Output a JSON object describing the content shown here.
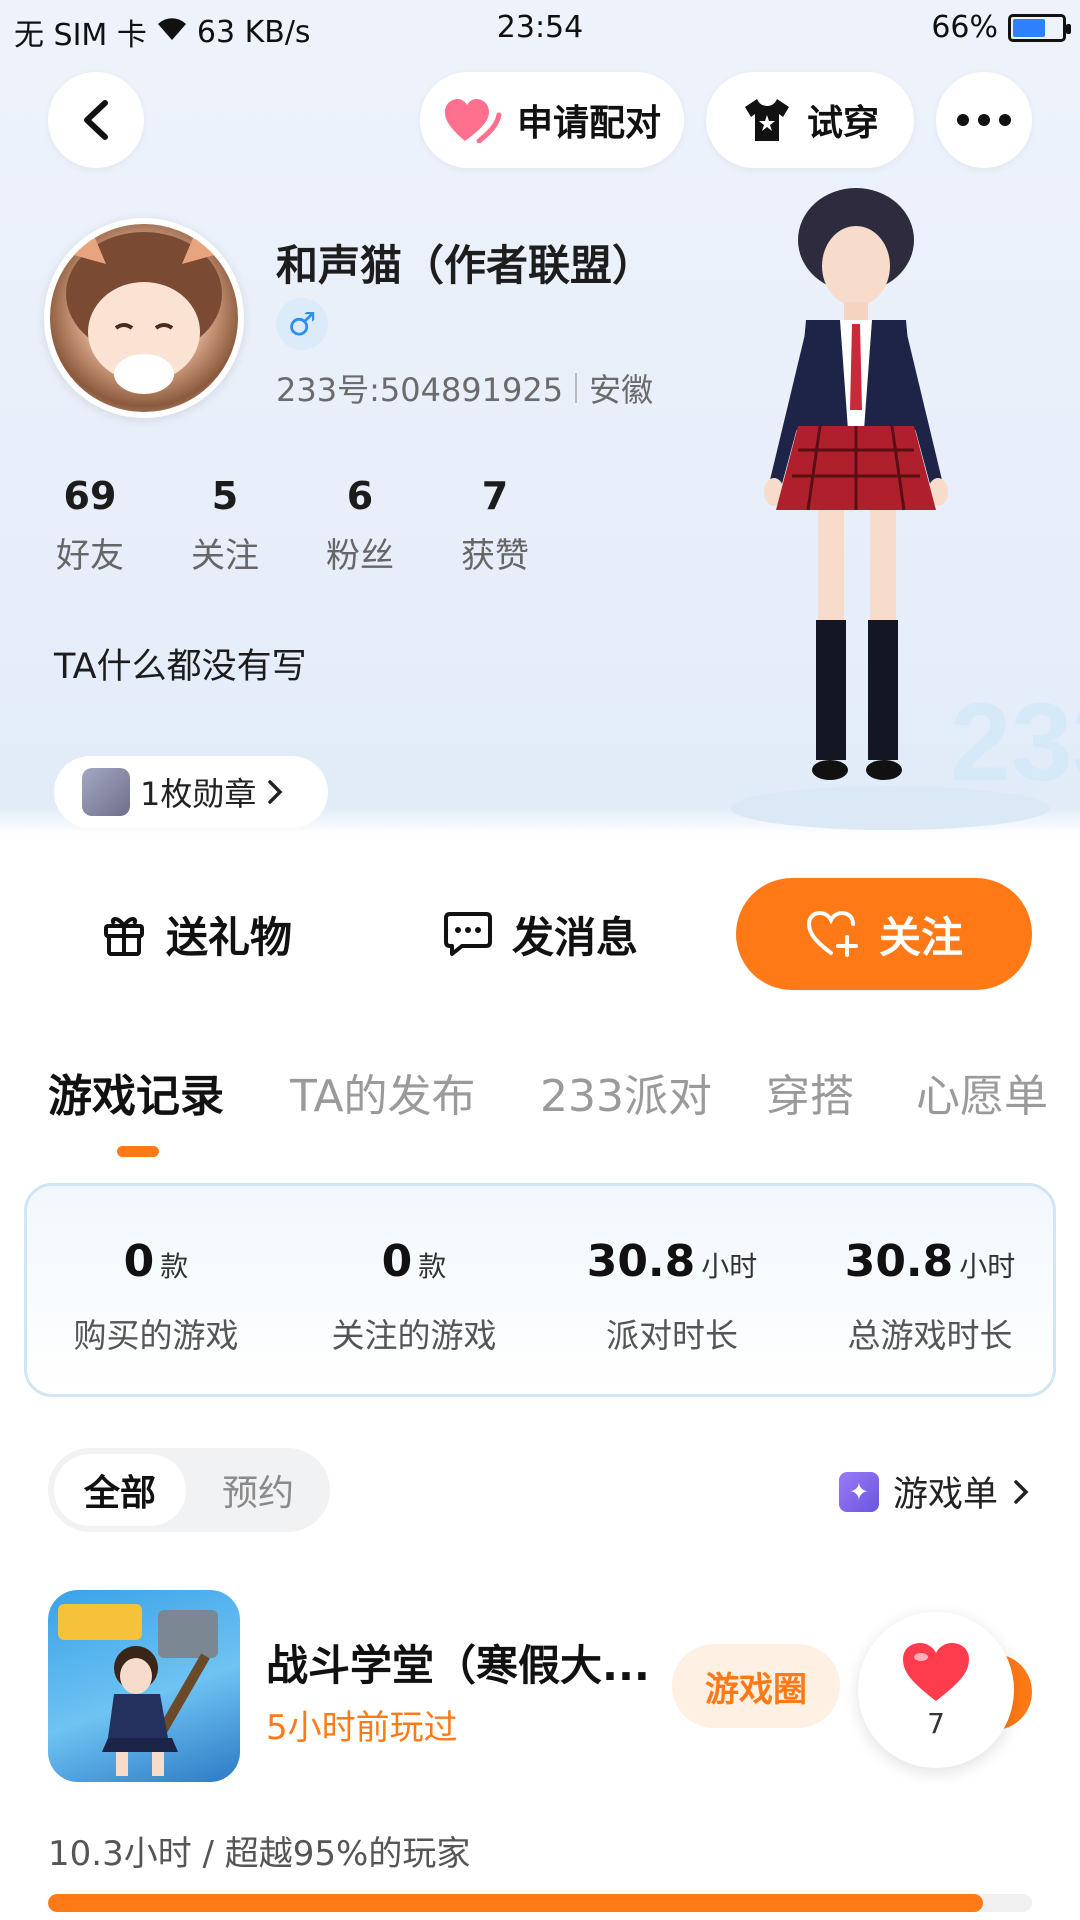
{
  "status_bar": {
    "carrier": "无 SIM 卡",
    "speed": "63 KB/s",
    "time": "23:54",
    "battery": "66%",
    "battery_level": 0.66
  },
  "header": {
    "back_icon": "chevron-left-icon",
    "match_label": "申请配对",
    "tryon_label": "试穿",
    "more_icon": "more-dots-icon"
  },
  "profile": {
    "name": "和声猫（作者联盟）",
    "gender_symbol": "♂",
    "uid": "233号:504891925",
    "region": "安徽",
    "stats": [
      {
        "value": "69",
        "label": "好友"
      },
      {
        "value": "5",
        "label": "关注"
      },
      {
        "value": "6",
        "label": "粉丝"
      },
      {
        "value": "7",
        "label": "获赞"
      }
    ],
    "bio": "TA什么都没有写",
    "medal": "1枚勋章"
  },
  "actions": {
    "gift": "送礼物",
    "message": "发消息",
    "follow": "关注"
  },
  "tabs": [
    "游戏记录",
    "TA的发布",
    "233派对",
    "穿搭",
    "心愿单"
  ],
  "summary": [
    {
      "value": "0",
      "unit": "款",
      "label": "购买的游戏"
    },
    {
      "value": "0",
      "unit": "款",
      "label": "关注的游戏"
    },
    {
      "value": "30.8",
      "unit": "小时",
      "label": "派对时长"
    },
    {
      "value": "30.8",
      "unit": "小时",
      "label": "总游戏时长"
    }
  ],
  "filter": {
    "all": "全部",
    "reserved": "预约",
    "game_list": "游戏单"
  },
  "game": {
    "title": "战斗学堂（寒假大...",
    "played": "5小时前玩过",
    "circle_tag": "游戏圈",
    "likes": "7",
    "playtime": "10.3小时 / 超越95%的玩家",
    "progress": 0.95
  },
  "colors": {
    "accent": "#ff7a16",
    "gender": "#2f8ff0"
  }
}
